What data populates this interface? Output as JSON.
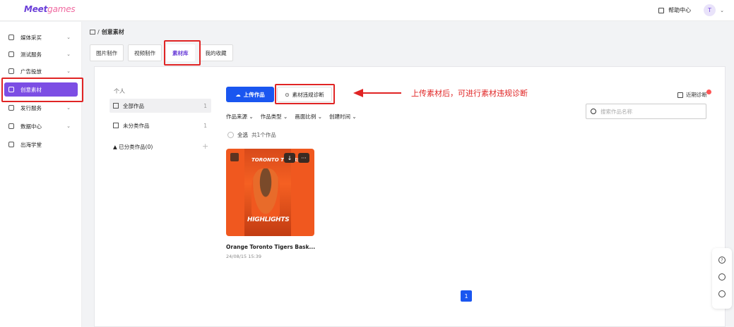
{
  "app": {
    "logo_main": "Meet",
    "logo_accent": "games"
  },
  "topbar": {
    "help_label": "帮助中心",
    "avatar_initial": "T"
  },
  "sidebar": {
    "items": [
      {
        "label": "媒体采买",
        "icon": "media-icon",
        "expandable": true
      },
      {
        "label": "测试服务",
        "icon": "folder-icon",
        "expandable": true
      },
      {
        "label": "广告投放",
        "icon": "monitor-icon",
        "expandable": true
      },
      {
        "label": "创意素材",
        "icon": "creative-icon",
        "expandable": false,
        "active": true
      },
      {
        "label": "发行服务",
        "icon": "publish-icon",
        "expandable": true
      },
      {
        "label": "数据中心",
        "icon": "chart-icon",
        "expandable": true
      },
      {
        "label": "出海学堂",
        "icon": "academy-icon",
        "expandable": false
      }
    ]
  },
  "breadcrumb": {
    "current": "创意素材"
  },
  "tabs": [
    {
      "label": "图片制作"
    },
    {
      "label": "视频制作"
    },
    {
      "label": "素材库",
      "active": true
    },
    {
      "label": "我的收藏"
    }
  ],
  "library": {
    "heading": "个人",
    "items": [
      {
        "label": "全部作品",
        "count": "1"
      },
      {
        "label": "未分类作品",
        "count": "1"
      },
      {
        "label": "▲ 已分类作品(0)"
      }
    ]
  },
  "toolbar": {
    "upload_label": "上传作品",
    "check_label": "素材违规诊断",
    "recent_label": "近期诊断",
    "search_placeholder": "搜索作品名称"
  },
  "annotation": {
    "text": "上传素材后，可进行素材违规诊断"
  },
  "filters": [
    {
      "label": "作品来源"
    },
    {
      "label": "作品类型"
    },
    {
      "label": "画面比例"
    },
    {
      "label": "创建时间"
    }
  ],
  "selection": {
    "select_all": "全选",
    "total": "共1个作品"
  },
  "works": [
    {
      "title": "Orange Toronto Tigers Bask...",
      "time": "24/08/15 15:39",
      "poster_top": "TORONTO TIGERS",
      "poster_bottom": "HIGHLIGHTS"
    }
  ],
  "pagination": {
    "current": "1"
  },
  "colors": {
    "brand": "#7c4ee4",
    "primary": "#1a56f0",
    "alert": "#e02424"
  }
}
